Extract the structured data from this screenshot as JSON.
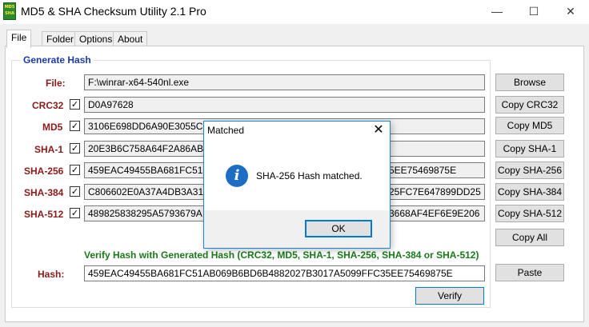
{
  "window": {
    "title": "MD5 & SHA Checksum Utility 2.1 Pro",
    "icon_text_top": "MD5",
    "icon_text_bottom": "SHA",
    "minimize": "—",
    "maximize": "☐",
    "close": "✕"
  },
  "tabs": [
    {
      "label": "File",
      "active": true
    },
    {
      "label": "Folder",
      "active": false
    },
    {
      "label": "Options",
      "active": false
    },
    {
      "label": "About",
      "active": false
    }
  ],
  "generate": {
    "group_title": "Generate Hash",
    "file_label": "File:",
    "file_value": "F:\\winrar-x64-540nl.exe",
    "browse_button": "Browse",
    "rows": [
      {
        "label": "CRC32",
        "checked": "✓",
        "value": "D0A97628",
        "button": "Copy CRC32"
      },
      {
        "label": "MD5",
        "checked": "✓",
        "value": "3106E698DD6A90E3055C",
        "button": "Copy MD5"
      },
      {
        "label": "SHA-1",
        "checked": "✓",
        "value": "20E3B6C758A64F2A86AB",
        "button": "Copy SHA-1"
      },
      {
        "label": "SHA-256",
        "checked": "✓",
        "value": "459EAC49455BA681FC51",
        "value_right": "5EE75469875E",
        "button": "Copy SHA-256"
      },
      {
        "label": "SHA-384",
        "checked": "✓",
        "value": "C806602E0A37A4DB3A31",
        "value_right": "25FC7E647899DD25",
        "button": "Copy SHA-384"
      },
      {
        "label": "SHA-512",
        "checked": "✓",
        "value": "489825838295A5793679A",
        "value_right": "3668AF4EF6E9E206",
        "button": "Copy SHA-512"
      }
    ],
    "copy_all_button": "Copy All"
  },
  "verify": {
    "title": "Verify Hash with Generated Hash (CRC32, MD5, SHA-1, SHA-256, SHA-384 or SHA-512)",
    "hash_label": "Hash:",
    "hash_value": "459EAC49455BA681FC51AB069B6BD6B4882027B3017A5099FFC35EE75469875E",
    "paste_button": "Paste",
    "verify_button": "Verify"
  },
  "dialog": {
    "title": "Matched",
    "close": "✕",
    "icon": "i",
    "message": "SHA-256 Hash matched.",
    "ok_button": "OK"
  }
}
